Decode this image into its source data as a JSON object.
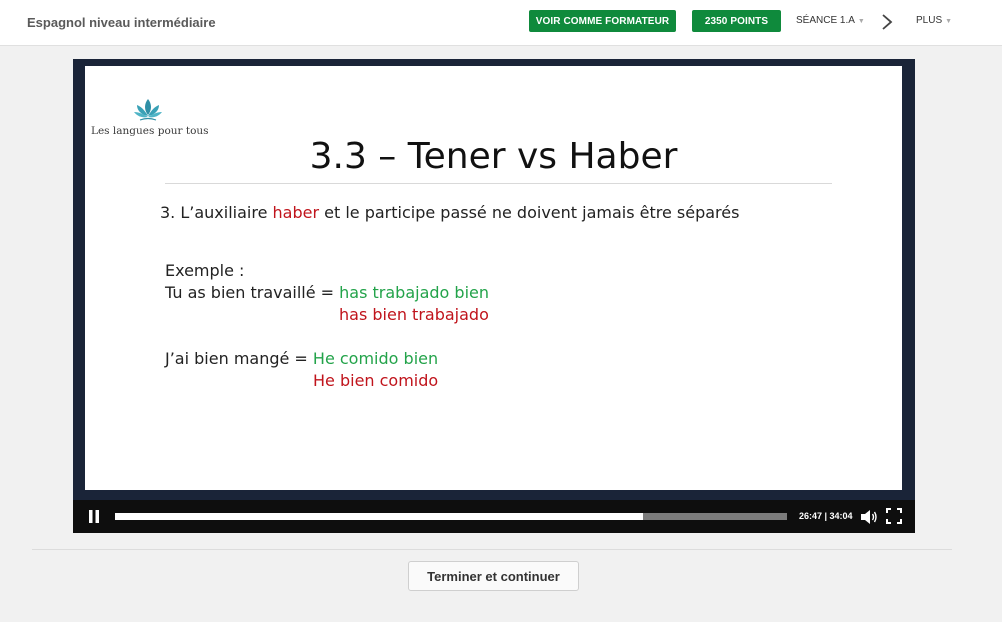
{
  "header": {
    "course_title": "Espagnol niveau intermédiaire",
    "trainer_button": "VOIR COMME FORMATEUR",
    "points_button": "2350 POINTS",
    "session_label": "SÉANCE 1.A",
    "more_label": "PLUS"
  },
  "slide": {
    "logo_text": "Les langues pour tous",
    "title": "3.3 – Tener vs Haber",
    "rule_prefix": "3. L’auxiliaire ",
    "rule_highlight": "haber",
    "rule_suffix": " et le participe passé ne doivent jamais être séparés",
    "example_heading": "Exemple :",
    "example1_fr": "Tu as bien travaillé = ",
    "example1_correct": "has trabajado bien",
    "example1_wrong": "has bien trabajado",
    "example2_fr": "J’ai bien mangé = ",
    "example2_correct": "He comido bien",
    "example2_wrong": "He bien comido"
  },
  "player": {
    "time_display": "26:47 | 34:04",
    "progress_percent": 78.6
  },
  "footer": {
    "finish_button": "Terminer et continuer"
  },
  "colors": {
    "accent_green": "#0f8a3c",
    "slide_red": "#c0141c",
    "slide_green": "#23a34a"
  }
}
